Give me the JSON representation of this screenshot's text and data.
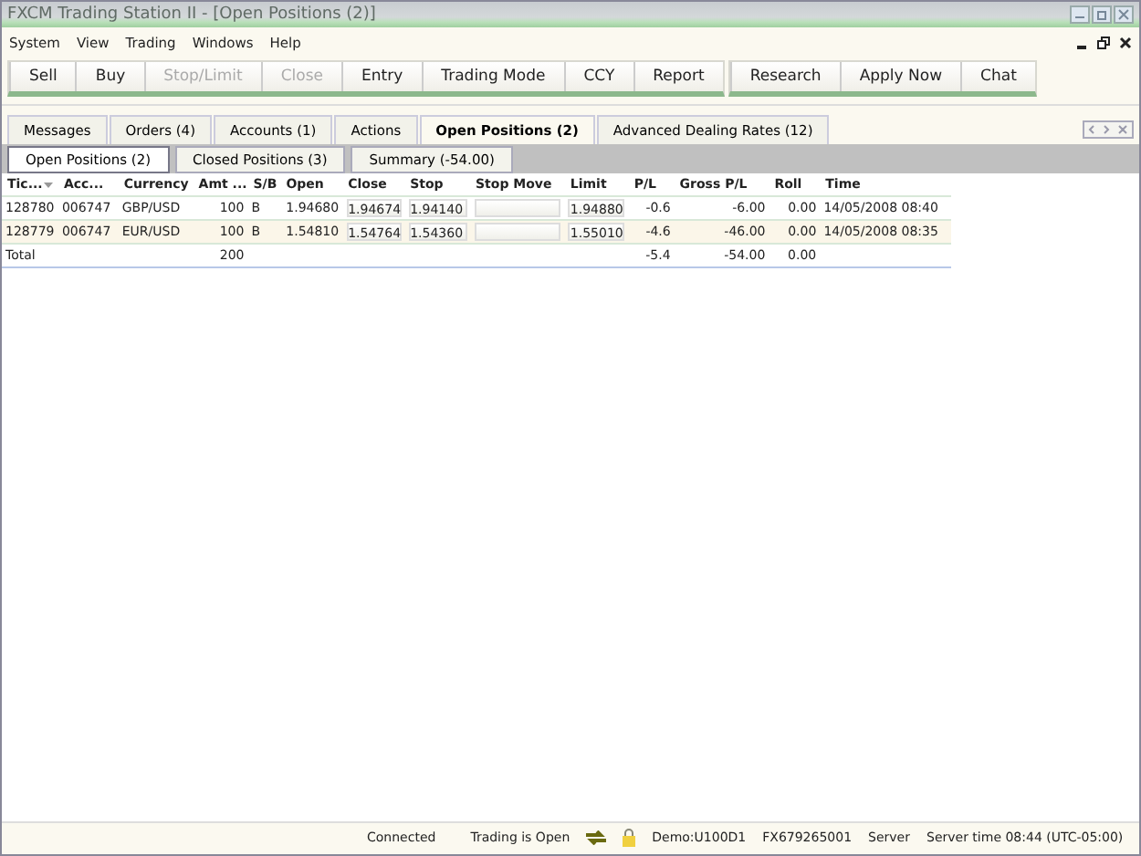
{
  "window": {
    "title": "FXCM Trading Station II - [Open Positions (2)]"
  },
  "menu": [
    "System",
    "View",
    "Trading",
    "Windows",
    "Help"
  ],
  "toolbar": [
    [
      {
        "label": "Sell",
        "disabled": false
      },
      {
        "label": "Buy",
        "disabled": false
      },
      {
        "label": "Stop/Limit",
        "disabled": true
      },
      {
        "label": "Close",
        "disabled": true
      },
      {
        "label": "Entry",
        "disabled": false
      },
      {
        "label": "Trading Mode",
        "disabled": false
      },
      {
        "label": "CCY",
        "disabled": false
      },
      {
        "label": "Report",
        "disabled": false
      }
    ],
    [
      {
        "label": "Research",
        "disabled": false
      },
      {
        "label": "Apply Now",
        "disabled": false
      },
      {
        "label": "Chat",
        "disabled": false
      }
    ]
  ],
  "tabs": [
    {
      "label": "Messages",
      "selected": false
    },
    {
      "label": "Orders (4)",
      "selected": false
    },
    {
      "label": "Accounts (1)",
      "selected": false
    },
    {
      "label": "Actions",
      "selected": false
    },
    {
      "label": "Open Positions (2)",
      "selected": true
    },
    {
      "label": "Advanced Dealing Rates (12)",
      "selected": false
    }
  ],
  "subtabs": [
    {
      "label": "Open Positions (2)",
      "selected": true
    },
    {
      "label": "Closed Positions (3)",
      "selected": false
    },
    {
      "label": "Summary (-54.00)",
      "selected": false
    }
  ],
  "table": {
    "columns": [
      {
        "label": "Tic...",
        "kind": "text",
        "sorted": true
      },
      {
        "label": "Acc...",
        "kind": "text",
        "sorted": false
      },
      {
        "label": "Currency",
        "kind": "text",
        "sorted": false
      },
      {
        "label": "Amt ...",
        "kind": "num",
        "sorted": false
      },
      {
        "label": "S/B",
        "kind": "text",
        "sorted": false
      },
      {
        "label": "Open",
        "kind": "num",
        "sorted": false
      },
      {
        "label": "Close",
        "kind": "field",
        "sorted": false
      },
      {
        "label": "Stop",
        "kind": "field",
        "sorted": false
      },
      {
        "label": "Stop Move",
        "kind": "field",
        "sorted": false
      },
      {
        "label": "Limit",
        "kind": "field",
        "sorted": false
      },
      {
        "label": "P/L",
        "kind": "num",
        "sorted": false
      },
      {
        "label": "Gross P/L",
        "kind": "num",
        "sorted": false
      },
      {
        "label": "Roll",
        "kind": "num",
        "sorted": false
      },
      {
        "label": "Time",
        "kind": "text",
        "sorted": false
      }
    ],
    "rows": [
      [
        "128780",
        "006747",
        "GBP/USD",
        "100",
        "B",
        "1.94680",
        "1.94674",
        "1.94140",
        null,
        "1.94880",
        "-0.6",
        "-6.00",
        "0.00",
        "14/05/2008 08:40"
      ],
      [
        "128779",
        "006747",
        "EUR/USD",
        "100",
        "B",
        "1.54810",
        "1.54764",
        "1.54360",
        null,
        "1.55010",
        "-4.6",
        "-46.00",
        "0.00",
        "14/05/2008 08:35"
      ]
    ],
    "total": {
      "label": "Total",
      "amount": "200",
      "pl": "-5.4",
      "gross_pl": "-54.00",
      "roll": "0.00"
    }
  },
  "status_bar": {
    "connection": "Connected",
    "trading": "Trading is Open",
    "account": "Demo:U100D1",
    "id": "FX679265001",
    "server": "Server",
    "time": "Server time 08:44 (UTC-05:00)"
  }
}
